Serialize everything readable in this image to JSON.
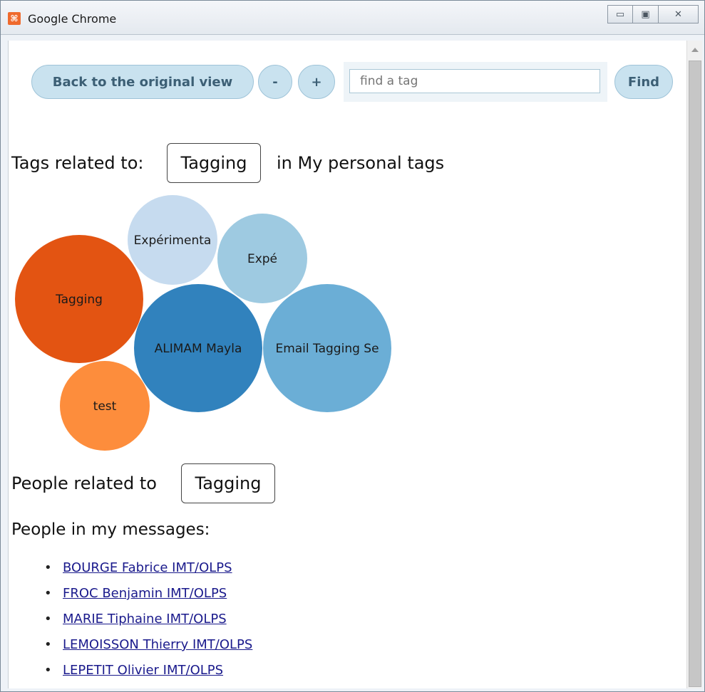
{
  "window": {
    "title": "Google Chrome",
    "icon_letter": "⌘"
  },
  "toolbar": {
    "back_label": "Back to the original view",
    "zoom_out_label": "-",
    "zoom_in_label": "+",
    "search_placeholder": "find a tag",
    "find_label": "Find"
  },
  "tags_section": {
    "prefix": "Tags related to:",
    "tag": "Tagging",
    "suffix": "in My personal tags"
  },
  "bubbles": [
    {
      "label": "Tagging",
      "color": "#e35412"
    },
    {
      "label": "Expérimenta",
      "color": "#c6dbef"
    },
    {
      "label": "Expé",
      "color": "#9ecae1"
    },
    {
      "label": "ALIMAM Mayla",
      "color": "#3182bd"
    },
    {
      "label": "Email Tagging Se",
      "color": "#6baed6"
    },
    {
      "label": "test",
      "color": "#fd8d3c"
    }
  ],
  "people_section": {
    "prefix": "People related to",
    "tag": "Tagging",
    "messages_heading": "People in my messages:",
    "people": [
      "BOURGE Fabrice IMT/OLPS",
      "FROC Benjamin IMT/OLPS",
      "MARIE Tiphaine IMT/OLPS",
      "LEMOISSON Thierry IMT/OLPS",
      "LEPETIT Olivier IMT/OLPS"
    ]
  },
  "colors": {
    "accent_pill": "#c9e2ef",
    "link": "#1a1a8c"
  }
}
